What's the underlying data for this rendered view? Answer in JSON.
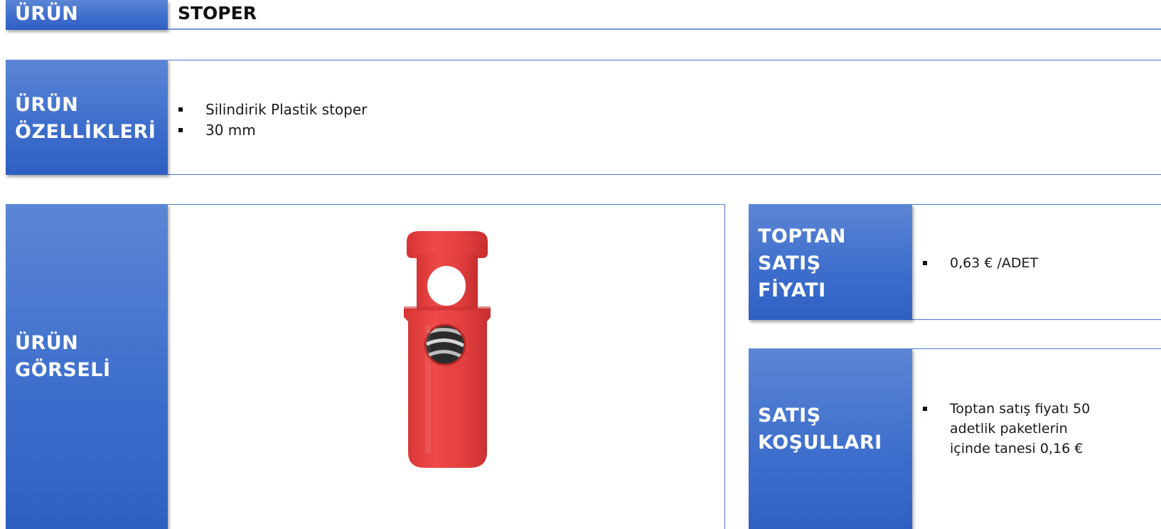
{
  "product_row": {
    "label": "ÜRÜN",
    "value": "STOPER"
  },
  "features_row": {
    "label_line1": "ÜRÜN",
    "label_line2": "ÖZELLİKLERİ",
    "items": [
      "Silindirik Plastik stoper",
      "30 mm"
    ]
  },
  "image_row": {
    "label_line1": "ÜRÜN",
    "label_line2": "GÖRSELİ",
    "product_color": "#e43b3b"
  },
  "wholesale_price": {
    "label_line1": "TOPTAN",
    "label_line2": "SATIŞ",
    "label_line3": "FİYATI",
    "items": [
      "0,63 € /ADET"
    ]
  },
  "sale_terms": {
    "label_line1": "SATIŞ",
    "label_line2": "KOŞULLARI",
    "item_lines": [
      "Toptan satış fiyatı 50",
      "adetlik paketlerin",
      "içinde tanesi 0,16 €"
    ]
  },
  "colors": {
    "label_blue": "#3f6fcd",
    "border_blue": "#4a78d6"
  }
}
